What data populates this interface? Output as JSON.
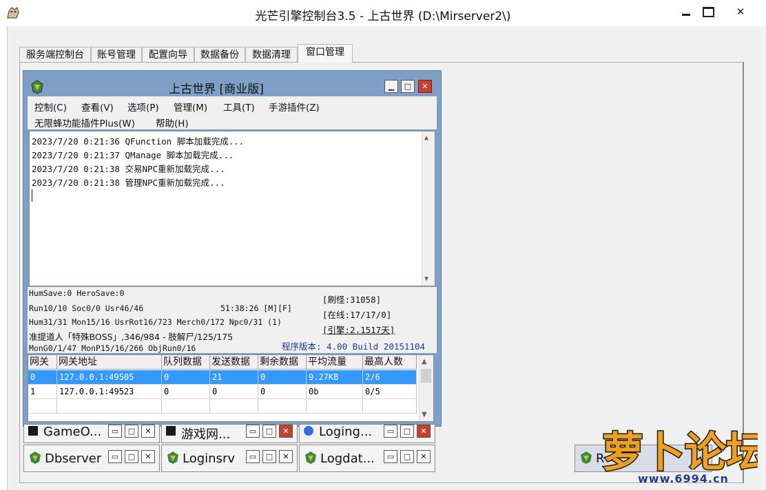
{
  "window": {
    "title": "光芒引擎控制台3.5 - 上古世界 (D:\\Mirserver2\\)",
    "close_glyph": "✕"
  },
  "tabs": [
    "服务端控制台",
    "账号管理",
    "配置向导",
    "数据备份",
    "数据清理",
    "窗口管理"
  ],
  "active_tab": "窗口管理",
  "server_window": {
    "title": "上古世界 [商业版]",
    "menu_row1": [
      "控制(C)",
      "查看(V)",
      "选项(P)",
      "管理(M)",
      "工具(T)",
      "手游插件(Z)"
    ],
    "menu_row2": [
      "无限蜂功能插件Plus(W)",
      "帮助(H)"
    ],
    "log_lines": [
      "2023/7/20 0:21:36 QFunction 脚本加载完成...",
      "2023/7/20 0:21:37 QManage 脚本加载完成...",
      "2023/7/20 0:21:38 交易NPC重新加载完成...",
      "2023/7/20 0:21:38 管理NPC重新加载完成..."
    ],
    "status": {
      "line1": "HumSave:0 HeroSave:0",
      "line2": "Run10/10 Soc0/0 Usr46/46",
      "time": "51:38:26 [M][F]",
      "line3": "Hum31/31 Mon15/16 UsrRot16/723 Merch0/172 Npc0/31 (1)",
      "line4": "准提道人「特殊BOSS」,346/984 - 肢解尸/125/175",
      "line5": "MonG0/1/47 MonP15/16/266 ObjRun0/16",
      "refresh": "[刷怪:31058]",
      "online": "[在线:17/17/0]",
      "engine": "[引擎:2.1517天]",
      "version": "程序版本: 4.00 Build 20151104"
    },
    "grid": {
      "headers": [
        "网关",
        "网关地址",
        "队列数据",
        "发送数据",
        "剩余数据",
        "平均流量",
        "最高人数"
      ],
      "rows": [
        [
          "0",
          "127.0.0.1:49505",
          "0",
          "21",
          "0",
          "9.27KB",
          "2/6"
        ],
        [
          "1",
          "127.0.0.1:49523",
          "0",
          "0",
          "0",
          "0b",
          "0/5"
        ]
      ]
    }
  },
  "minimized": [
    {
      "label": "GameO..."
    },
    {
      "label": "游戏网..."
    },
    {
      "label": "Loging..."
    },
    {
      "label": "Dbserver"
    },
    {
      "label": "Loginsrv"
    },
    {
      "label": "Logdat..."
    },
    {
      "label": "R"
    }
  ],
  "watermark": {
    "text": "萝卜论坛",
    "url": "www.6994.cn"
  },
  "colors": {
    "accent_blue": "#3399ff",
    "mdi_frame": "#7ea0c6",
    "close_red": "#c8402d",
    "version_blue": "#1b3a9a"
  }
}
